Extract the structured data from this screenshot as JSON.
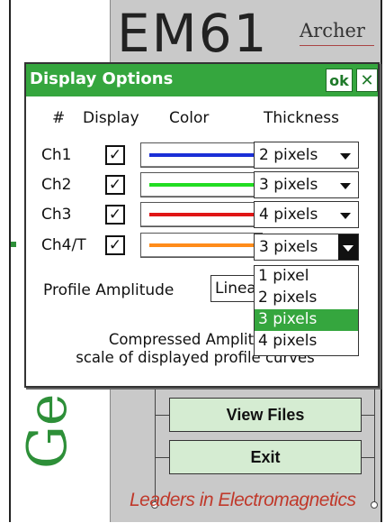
{
  "background": {
    "logo_text": "EM61",
    "brand_text": "Archer",
    "side_logo": "Ge",
    "buttons": {
      "view_files": "View Files",
      "exit": "Exit"
    },
    "tagline": "Leaders in Electromagnetics"
  },
  "dialog": {
    "title": "Display Options",
    "ok_label": "ok",
    "close_label": "✕",
    "headers": {
      "num": "#",
      "display": "Display",
      "color": "Color",
      "thickness": "Thickness"
    },
    "channels": [
      {
        "label": "Ch1",
        "checked": "✓",
        "color": "#1a2fd6",
        "thickness": "2 pixels"
      },
      {
        "label": "Ch2",
        "checked": "✓",
        "color": "#22dd22",
        "thickness": "3 pixels"
      },
      {
        "label": "Ch3",
        "checked": "✓",
        "color": "#e01515",
        "thickness": "4 pixels"
      },
      {
        "label": "Ch4/T",
        "checked": "✓",
        "color": "#ff8c1a",
        "thickness": "3 pixels"
      }
    ],
    "profile_amplitude": {
      "label": "Profile Amplitude",
      "value": "Linea"
    },
    "note_line1": "Compressed Amplitude",
    "note_line2": "scale of displayed profile curves",
    "dropdown_options": [
      {
        "label": "1 pixel",
        "selected": false
      },
      {
        "label": "2 pixels",
        "selected": false
      },
      {
        "label": "3 pixels",
        "selected": true
      },
      {
        "label": "4 pixels",
        "selected": false
      }
    ]
  },
  "colors": {
    "title_bar": "#35a63e",
    "menu_button": "#d5ecd2",
    "tagline": "#c0392b"
  }
}
